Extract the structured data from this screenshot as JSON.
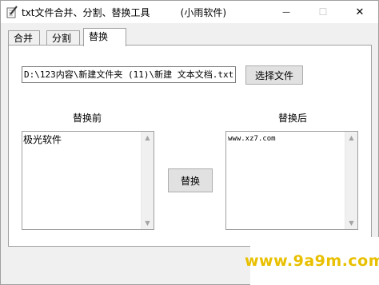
{
  "window": {
    "title": "txt文件合并、分割、替换工具          (小雨软件)",
    "close_label": "✕",
    "minimize_label": "—",
    "maximize_label": "☐"
  },
  "tabs": [
    {
      "label": "合并",
      "active": false
    },
    {
      "label": "分割",
      "active": false
    },
    {
      "label": "替换",
      "active": true
    }
  ],
  "replace": {
    "file_path": "D:\\123内容\\新建文件夹 (11)\\新建 文本文档.txt",
    "choose_file_label": "选择文件",
    "before_label": "替换前",
    "after_label": "替换后",
    "before_text": "极光软件",
    "after_text": "www.xz7.com",
    "replace_button_label": "替换"
  },
  "watermark": {
    "text": "www.9a9m.com",
    "color": "#e8c000"
  }
}
